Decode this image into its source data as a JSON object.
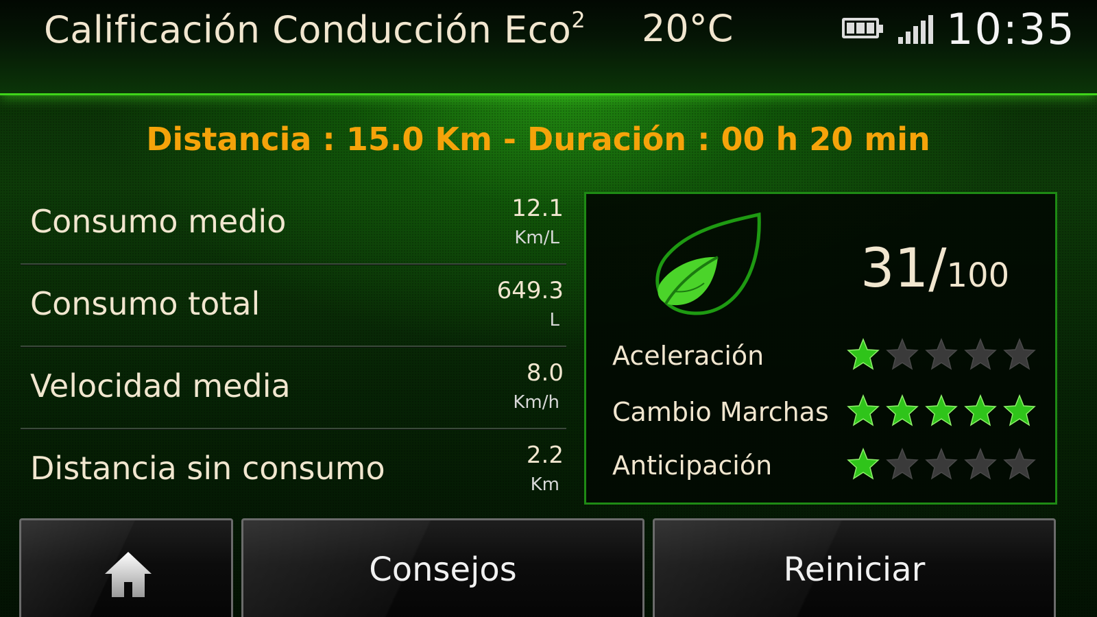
{
  "header": {
    "title": "Calificación Conducción Eco",
    "title_superscript": "2",
    "temperature": "20°C",
    "battery_icon": "battery-icon",
    "signal_icon": "signal-strength-icon",
    "clock": "10:35"
  },
  "trip": {
    "summary": "Distancia : 15.0 Km - Duración : 00 h 20 min"
  },
  "metrics": [
    {
      "label": "Consumo medio",
      "value": "12.1",
      "unit": "Km/L"
    },
    {
      "label": "Consumo total",
      "value": "649.3",
      "unit": "L"
    },
    {
      "label": "Velocidad media",
      "value": "8.0",
      "unit": "Km/h"
    },
    {
      "label": "Distancia sin consumo",
      "value": "2.2",
      "unit": "Km"
    }
  ],
  "score": {
    "icon": "leaf-icon",
    "value": "31",
    "separator": "/",
    "max": "100",
    "ratings": [
      {
        "label": "Aceleración",
        "stars": 1,
        "max_stars": 5
      },
      {
        "label": "Cambio Marchas",
        "stars": 5,
        "max_stars": 5
      },
      {
        "label": "Anticipación",
        "stars": 1,
        "max_stars": 5
      }
    ]
  },
  "buttons": {
    "home_icon": "home-icon",
    "tips_label": "Consejos",
    "reset_label": "Reiniciar"
  },
  "colors": {
    "accent_green": "#3fd41a",
    "summary_orange": "#f5a30a",
    "star_on": "#2fc41a",
    "star_off": "#3a3a3a",
    "text": "#f1e6cf"
  }
}
